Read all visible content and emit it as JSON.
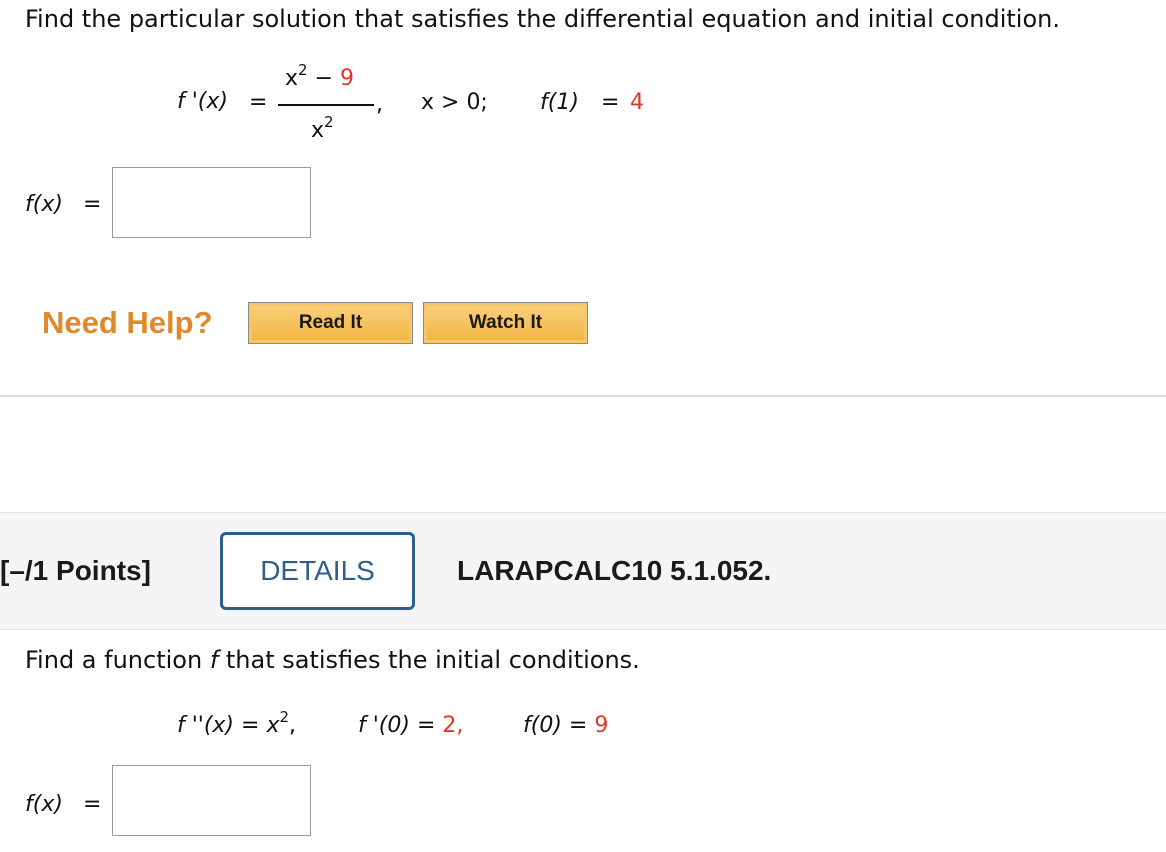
{
  "q1": {
    "prompt": "Find the particular solution that satisfies the differential equation and initial condition.",
    "lhs": "f '(x)",
    "eq": "=",
    "num_base": "x",
    "num_exp": "2",
    "num_minus": "−",
    "num_const": "9",
    "den_base": "x",
    "den_exp": "2",
    "comma": ",",
    "condition": "x > 0;",
    "ic_lhs": "f(1)",
    "ic_eq": "=",
    "ic_val": "4",
    "answer_label": "f(x)",
    "answer_eq": "=",
    "answer_value": ""
  },
  "help": {
    "label": "Need Help?",
    "read_it": "Read It",
    "watch_it": "Watch It"
  },
  "q2": {
    "points": "[–/1 Points]",
    "details": "DETAILS",
    "code": "LARAPCALC10 5.1.052.",
    "prompt_a": "Find a function ",
    "prompt_f": "f",
    "prompt_b": " that satisfies the initial conditions.",
    "c1_lhs": "f ''(x) = x",
    "c1_exp": "2",
    "c1_comma": ",",
    "c2_lhs": "f '(0) =",
    "c2_val": "2,",
    "c3_lhs": "f(0)",
    "c3_eq": "=",
    "c3_val": "9",
    "answer_label": "f(x)",
    "answer_eq": "=",
    "answer_value": ""
  },
  "colors": {
    "accent_red": "#d93a26",
    "help_orange": "#e0892a",
    "details_blue": "#2f5d8c"
  }
}
